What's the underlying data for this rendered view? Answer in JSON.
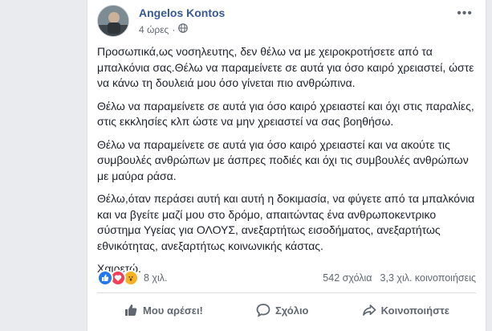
{
  "post": {
    "author": "Angelos Kontos",
    "time": "4 ώρες",
    "privacy_icon": "public-globe-icon",
    "paragraphs": [
      "Προσωπικά,ως νοσηλευτης, δεν θέλω να με χειροκροτήσετε από τα μπαλκόνια σας.Θέλω να παραμείνετε σε αυτά για όσο καιρό χρειαστεί, ώστε να κάνω τη δουλειά μου όσο γίνεται πιο ανθρώπινα.",
      "Θέλω να παραμείνετε σε αυτά για όσο καιρό χρειαστεί και όχι στις παραλίες, στις εκκλησίες κλπ ώστε να μην χρειαστεί να σας βοηθήσω.",
      "Θέλω να παραμείνετε σε αυτά για όσο καιρό χρειαστεί και να ακούτε τις συμβουλές ανθρώπων με άσπρες ποδιές και όχι τις συμβουλές ανθρώπων με μαύρα ράσα.",
      "Θέλω,όταν περάσει αυτή και αυτή η δοκιμασία, να φύγετε από τα μπαλκόνια και να βγείτε μαζί μου στο δρόμο, απαιτώντας ένα ανθρωποκεντρικο σύστημα Υγείας για ΟΛΟΥΣ, ανεξαρτήτως εισοδήματος, ανεξαρτήτως εθνικότητας, ανεξαρτήτως κοινωνικής κάστας.",
      "Χαιρετώ."
    ]
  },
  "stats": {
    "reactions_count": "8 χιλ.",
    "comments": "542 σχόλια",
    "shares": "3,3 χιλ. κοινοποιήσεις"
  },
  "actions": {
    "like": "Μου αρέσει!",
    "comment": "Σχόλιο",
    "share": "Κοινοποιήστε"
  },
  "colors": {
    "author_link": "#385898",
    "like_blue": "#2078f4",
    "love_red": "#f33e58",
    "wow_yellow": "#f7b125"
  }
}
